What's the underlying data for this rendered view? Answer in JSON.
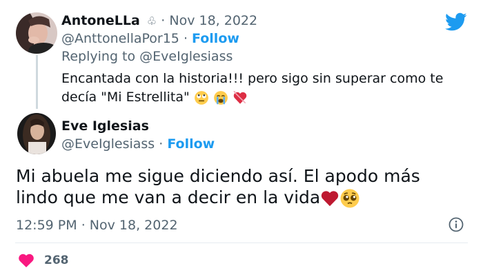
{
  "reply": {
    "display_name": "AntoneLLa",
    "name_symbol": "♧",
    "date": "Nov 18, 2022",
    "handle": "@AnttonellaPor15",
    "follow_label": "Follow",
    "replying_prefix": "Replying to",
    "replying_handle": "@EveIglesiass",
    "text_line1": "Encantada con la historia!!! pero sigo sin superar como te",
    "text_line2": "decía \"Mi Estrellita\""
  },
  "main": {
    "display_name": "Eve Iglesias",
    "handle": "@EveIglesiass",
    "follow_label": "Follow",
    "text_line1": "Mi abuela me sigue diciendo así. El apodo más",
    "text_line2": "lindo que me van a decir en la vida",
    "time": "12:59 PM",
    "date": "Nov 18, 2022"
  },
  "stats": {
    "likes": "268"
  },
  "separator": "·",
  "icons": {
    "brand": "twitter-bird-icon",
    "info": "info-icon",
    "like": "heart-icon",
    "reply_emojis": [
      "rolling-eyes-face-emoji",
      "crying-face-emoji",
      "heart-with-ribbon-emoji"
    ],
    "main_emojis": [
      "red-heart-emoji",
      "pleading-face-emoji"
    ]
  },
  "colors": {
    "accent": "#1d9bf0",
    "like": "#f91880",
    "muted": "#536471",
    "line": "#cfd9de"
  }
}
